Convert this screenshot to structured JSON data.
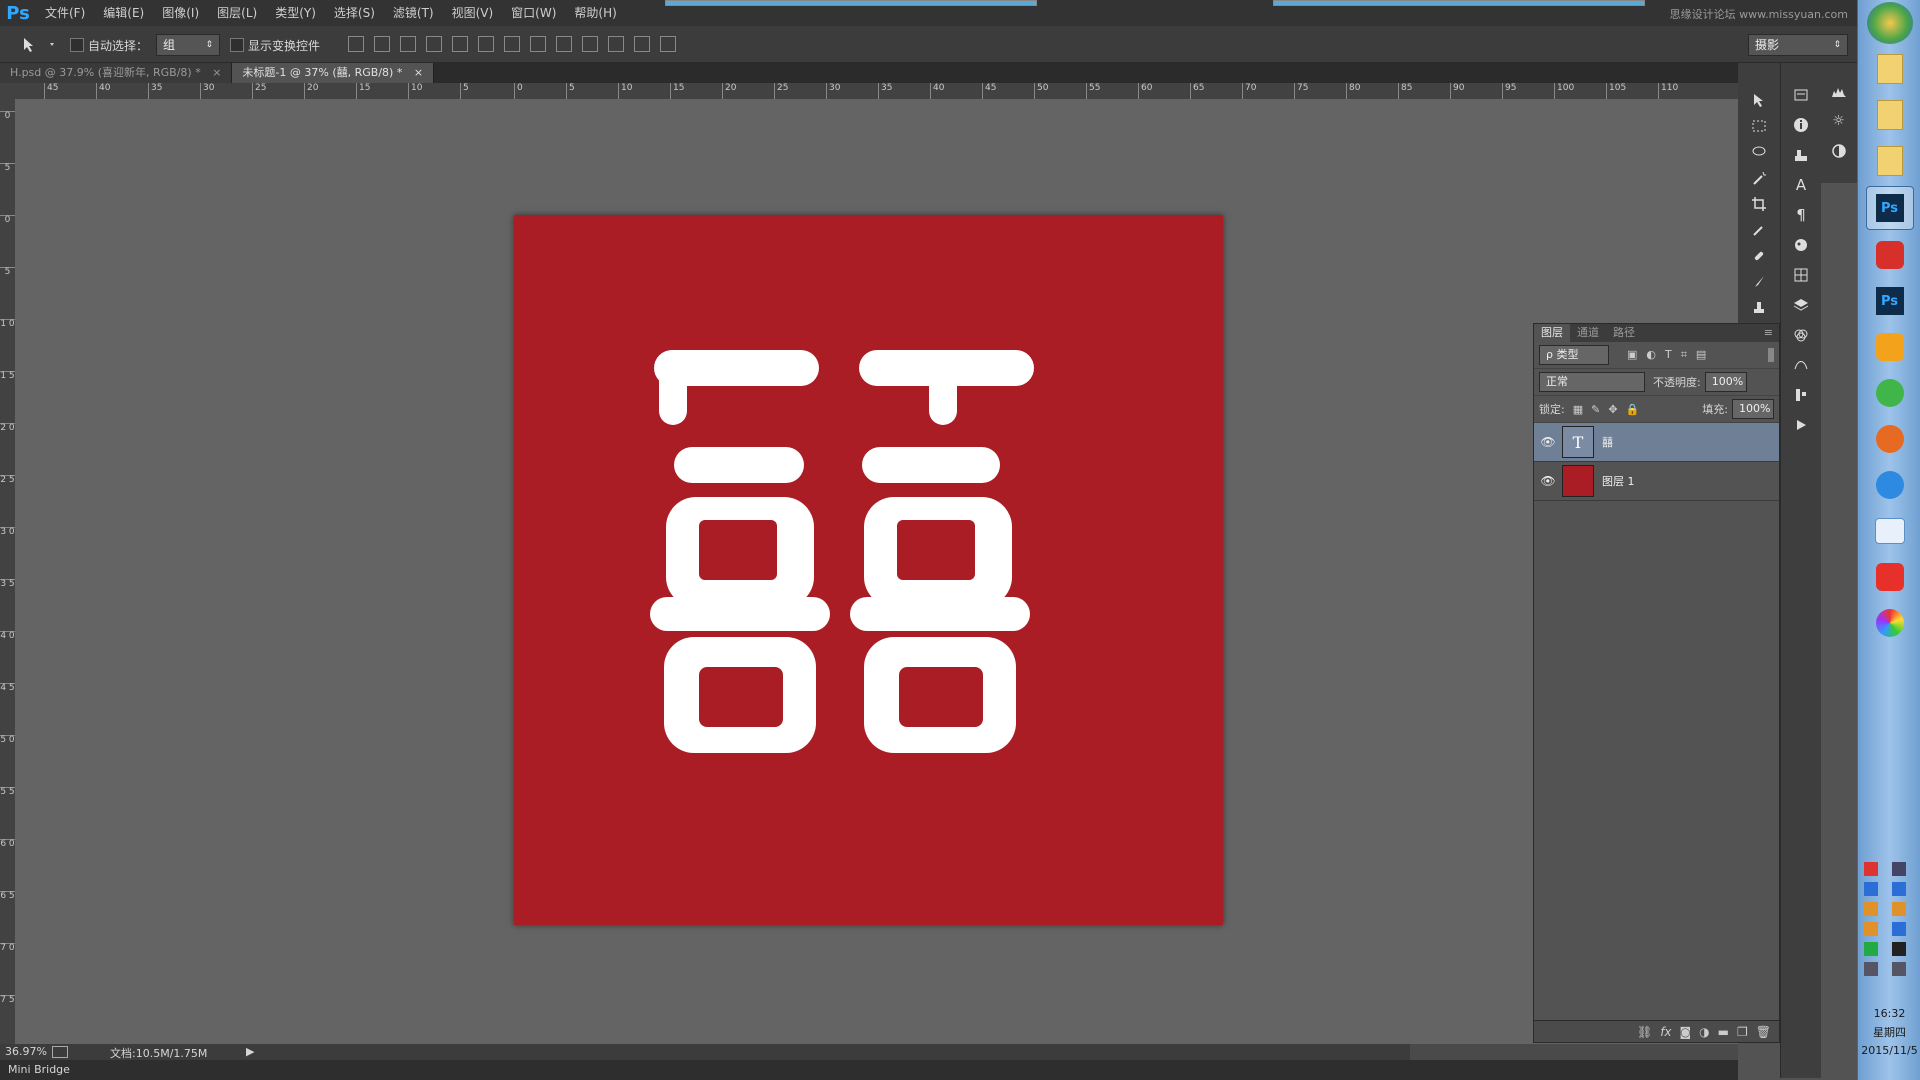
{
  "app": {
    "logo": "Ps"
  },
  "menu": [
    "文件(F)",
    "编辑(E)",
    "图像(I)",
    "图层(L)",
    "类型(Y)",
    "选择(S)",
    "滤镜(T)",
    "视图(V)",
    "窗口(W)",
    "帮助(H)"
  ],
  "watermark": "思缘设计论坛 www.missyuan.com",
  "options": {
    "auto_select_label": "自动选择：",
    "auto_select_value": "组",
    "show_transform_label": "显示变换控件",
    "workspace_value": "摄影"
  },
  "tabs": [
    {
      "label": "H.psd @ 37.9% (喜迎新年, RGB/8) *",
      "close": "×"
    },
    {
      "label": "未标题-1 @ 37% (囍, RGB/8) *",
      "close": "×"
    }
  ],
  "ruler_h": [
    "45",
    "40",
    "35",
    "30",
    "25",
    "20",
    "15",
    "10",
    "5",
    "0",
    "5",
    "10",
    "15",
    "20",
    "25",
    "30",
    "35",
    "40",
    "45",
    "50",
    "55",
    "60",
    "65",
    "70",
    "75",
    "80",
    "85",
    "90",
    "95",
    "100",
    "105",
    "110"
  ],
  "ruler_v": [
    "0",
    "5",
    "0",
    "5",
    "1 0",
    "1 5",
    "2 0",
    "2 5",
    "3 0",
    "3 5",
    "4 0",
    "4 5",
    "5 0",
    "5 5",
    "6 0",
    "6 5",
    "7 0",
    "7 5"
  ],
  "canvas": {
    "artboard_color": "#aa1d25",
    "glyph": "囍",
    "glyph_color": "#ffffff"
  },
  "layers_panel": {
    "tabs": [
      "图层",
      "通道",
      "路径"
    ],
    "filter_label": "ρ 类型",
    "blend_mode": "正常",
    "opacity_label": "不透明度:",
    "opacity_value": "100%",
    "lock_label": "锁定:",
    "fill_label": "填充:",
    "fill_value": "100%",
    "layers": [
      {
        "name": "囍",
        "type": "text",
        "thumb_glyph": "T",
        "selected": true
      },
      {
        "name": "图层 1",
        "type": "pixel",
        "thumb_color": "#aa1d25",
        "selected": false
      }
    ],
    "footer_icons": [
      "link-icon",
      "fx-icon",
      "mask-icon",
      "adjustment-icon",
      "folder-icon",
      "new-layer-icon",
      "trash-icon"
    ]
  },
  "status": {
    "zoom": "36.97%",
    "doc_info": "文档:10.5M/1.75M"
  },
  "mini_bridge": "Mini Bridge",
  "taskbar": {
    "time": "16:32",
    "weekday": "星期四",
    "date": "2015/11/5",
    "apps": [
      "folder-1",
      "folder-2",
      "folder-3",
      "ps-active",
      "app-red",
      "ps",
      "app-orange",
      "app-green",
      "app-firefox",
      "app-browser",
      "app-chat",
      "app-red2",
      "app-color"
    ]
  }
}
